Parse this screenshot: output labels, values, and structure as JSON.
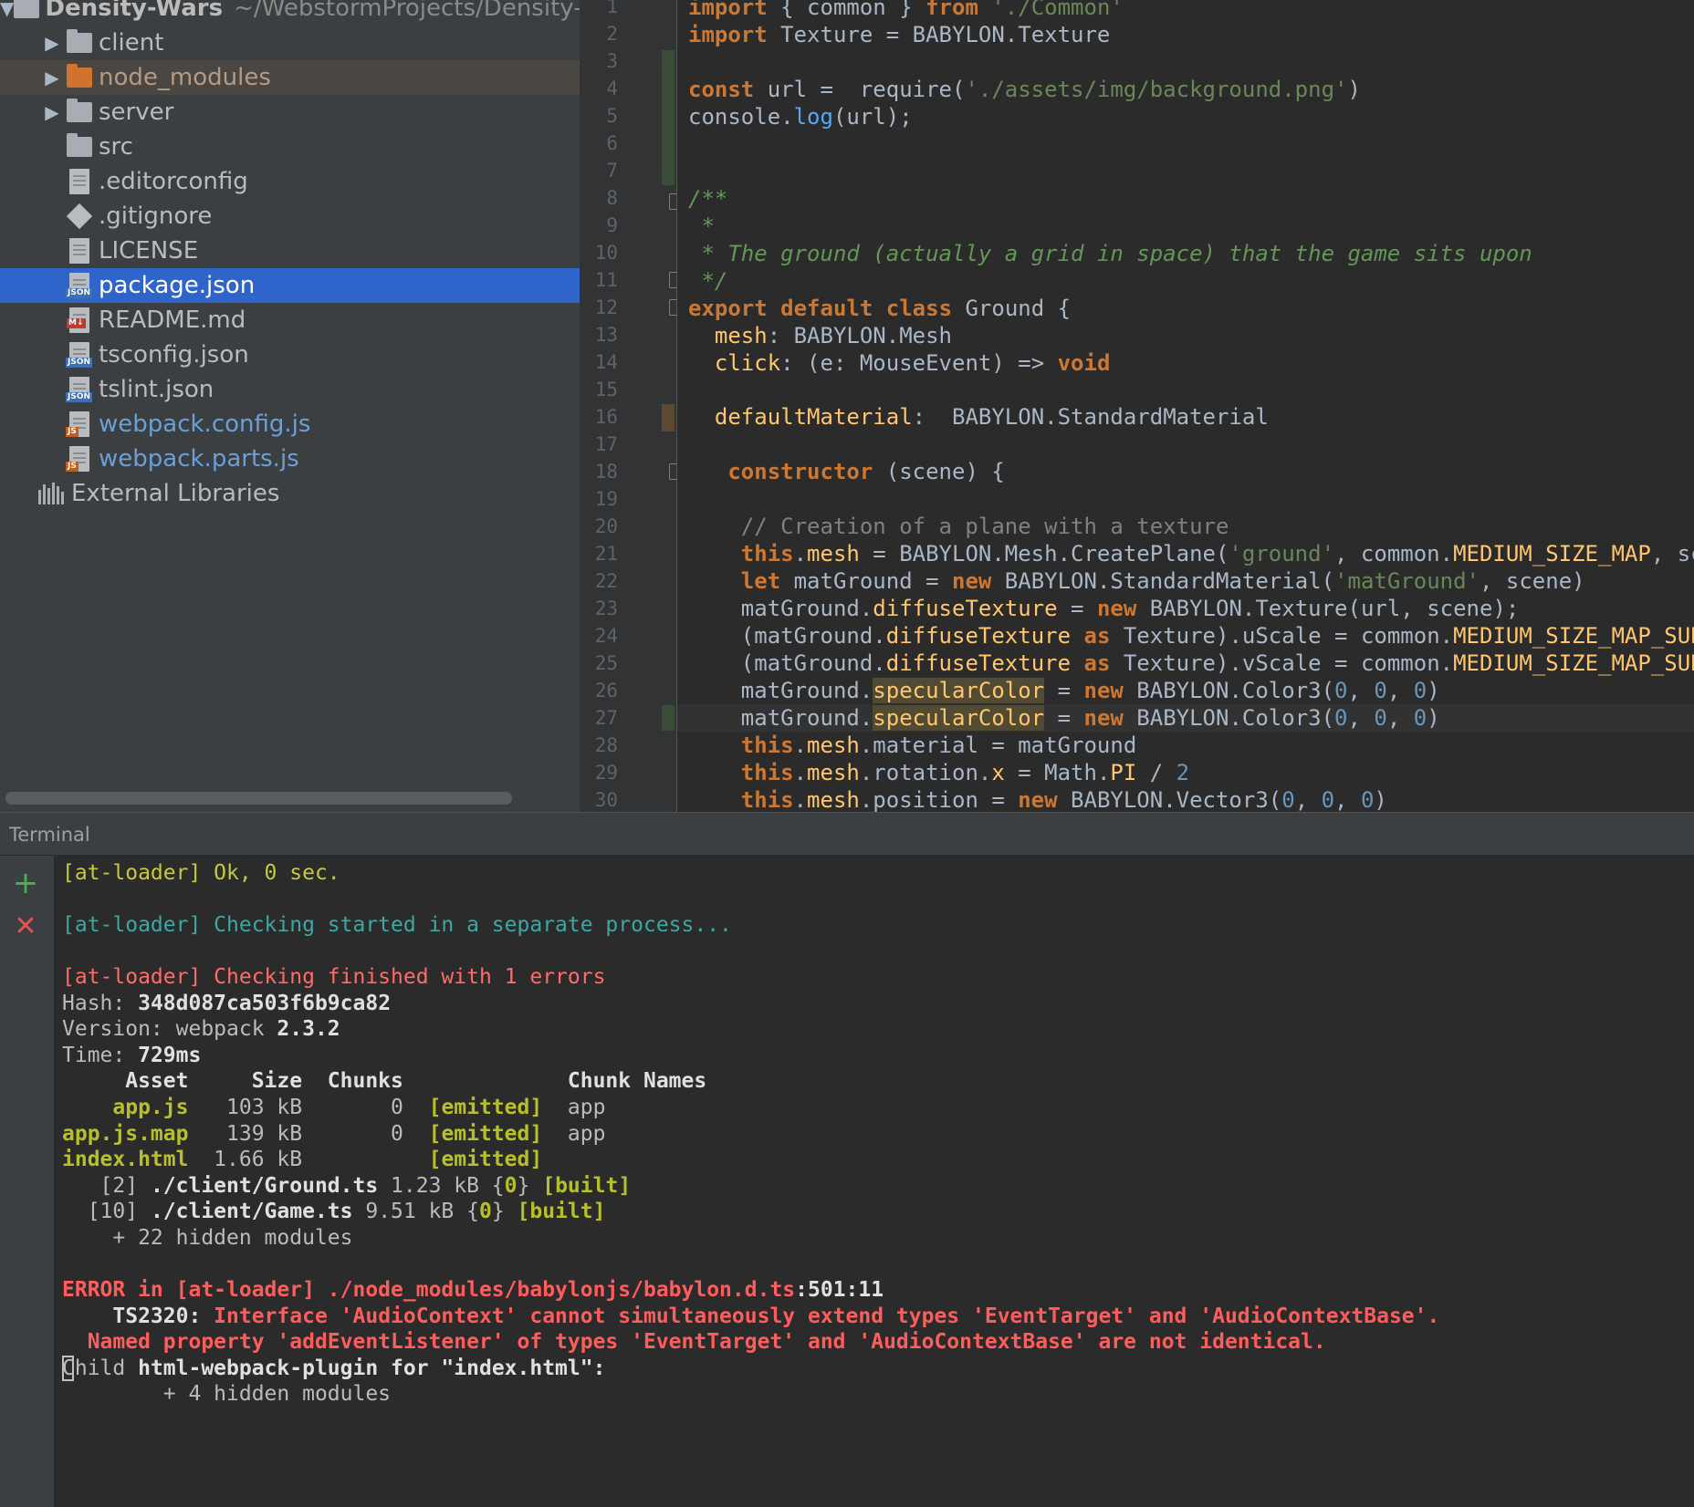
{
  "project_tree": {
    "root": {
      "name": "Density-Wars",
      "path": "~/WebstormProjects/Density-"
    },
    "items": [
      {
        "label": "client",
        "type": "folder",
        "expandable": true
      },
      {
        "label": "node_modules",
        "type": "folder-excluded",
        "expandable": true
      },
      {
        "label": "server",
        "type": "folder",
        "expandable": true
      },
      {
        "label": "src",
        "type": "folder",
        "expandable": false
      },
      {
        "label": ".editorconfig",
        "type": "text-file"
      },
      {
        "label": ".gitignore",
        "type": "git-file"
      },
      {
        "label": "LICENSE",
        "type": "text-file"
      },
      {
        "label": "package.json",
        "type": "json-file",
        "selected": true
      },
      {
        "label": "README.md",
        "type": "md-file"
      },
      {
        "label": "tsconfig.json",
        "type": "json-file"
      },
      {
        "label": "tslint.json",
        "type": "json-file"
      },
      {
        "label": "webpack.config.js",
        "type": "js-file"
      },
      {
        "label": "webpack.parts.js",
        "type": "js-file"
      }
    ],
    "external_libraries": "External Libraries"
  },
  "editor": {
    "lines": [
      {
        "n": "1",
        "t": "import { common } from './Common'"
      },
      {
        "n": "2",
        "t": "import Texture = BABYLON.Texture"
      },
      {
        "n": "3",
        "t": ""
      },
      {
        "n": "4",
        "t": "const url =  require('./assets/img/background.png')"
      },
      {
        "n": "5",
        "t": "console.log(url);"
      },
      {
        "n": "6",
        "t": ""
      },
      {
        "n": "7",
        "t": ""
      },
      {
        "n": "8",
        "t": "/**"
      },
      {
        "n": "9",
        "t": " *"
      },
      {
        "n": "10",
        "t": " * The ground (actually a grid in space) that the game sits upon"
      },
      {
        "n": "11",
        "t": " */"
      },
      {
        "n": "12",
        "t": "export default class Ground {"
      },
      {
        "n": "13",
        "t": "  mesh: BABYLON.Mesh"
      },
      {
        "n": "14",
        "t": "  click: (e: MouseEvent) => void"
      },
      {
        "n": "15",
        "t": ""
      },
      {
        "n": "16",
        "t": "  defaultMaterial:  BABYLON.StandardMaterial"
      },
      {
        "n": "17",
        "t": ""
      },
      {
        "n": "18",
        "t": "   constructor (scene) {"
      },
      {
        "n": "19",
        "t": ""
      },
      {
        "n": "20",
        "t": "    // Creation of a plane with a texture"
      },
      {
        "n": "21",
        "t": "    this.mesh = BABYLON.Mesh.CreatePlane('ground', common.MEDIUM_SIZE_MAP, scen"
      },
      {
        "n": "22",
        "t": "    let matGround = new BABYLON.StandardMaterial('matGround', scene)"
      },
      {
        "n": "23",
        "t": "    matGround.diffuseTexture = new BABYLON.Texture(url, scene);"
      },
      {
        "n": "24",
        "t": "    (matGround.diffuseTexture as Texture).uScale = common.MEDIUM_SIZE_MAP_SUBDI"
      },
      {
        "n": "25",
        "t": "    (matGround.diffuseTexture as Texture).vScale = common.MEDIUM_SIZE_MAP_SUBDI"
      },
      {
        "n": "26",
        "t": "    matGround.specularColor = new BABYLON.Color3(0, 0, 0)"
      },
      {
        "n": "27",
        "t": "    matGround.specularColor = new BABYLON.Color3(0, 0, 0)"
      },
      {
        "n": "28",
        "t": "    this.mesh.material = matGround"
      },
      {
        "n": "29",
        "t": "    this.mesh.rotation.x = Math.PI / 2"
      },
      {
        "n": "30",
        "t": "    this.mesh.position = new BABYLON.Vector3(0, 0, 0)"
      }
    ]
  },
  "terminal": {
    "title": "Terminal",
    "add_icon": "+",
    "close_icon": "✕",
    "lines": [
      "[at-loader] Ok, 0 sec.",
      "",
      "[at-loader] Checking started in a separate process...",
      "",
      "[at-loader] Checking finished with 1 errors",
      "Hash: 348d087ca503f6b9ca82",
      "Version: webpack 2.3.2",
      "Time: 729ms",
      "     Asset     Size  Chunks             Chunk Names",
      "    app.js   103 kB       0  [emitted]  app",
      "app.js.map   139 kB       0  [emitted]  app",
      "index.html  1.66 kB          [emitted]",
      "   [2] ./client/Ground.ts 1.23 kB {0} [built]",
      "  [10] ./client/Game.ts 9.51 kB {0} [built]",
      "    + 22 hidden modules",
      "",
      "ERROR in [at-loader] ./node_modules/babylonjs/babylon.d.ts:501:11",
      "    TS2320: Interface 'AudioContext' cannot simultaneously extend types 'EventTarget' and 'AudioContextBase'.",
      "  Named property 'addEventListener' of types 'EventTarget' and 'AudioContextBase' are not identical.",
      "Child html-webpack-plugin for \"index.html\":",
      "        + 4 hidden modules"
    ]
  }
}
